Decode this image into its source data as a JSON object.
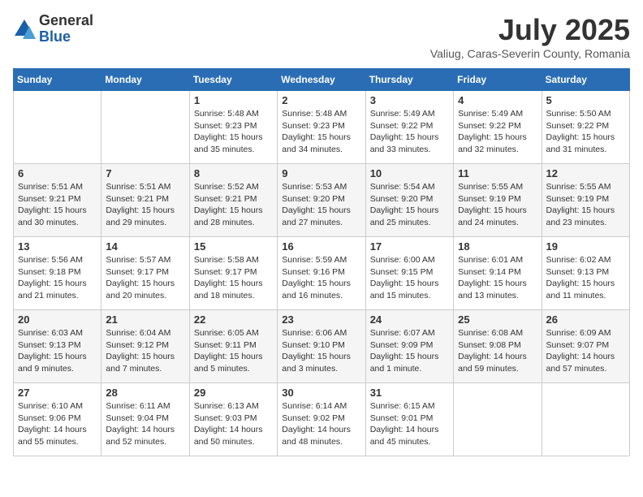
{
  "logo": {
    "general": "General",
    "blue": "Blue"
  },
  "title": "July 2025",
  "subtitle": "Valiug, Caras-Severin County, Romania",
  "headers": [
    "Sunday",
    "Monday",
    "Tuesday",
    "Wednesday",
    "Thursday",
    "Friday",
    "Saturday"
  ],
  "weeks": [
    [
      {
        "day": "",
        "text": ""
      },
      {
        "day": "",
        "text": ""
      },
      {
        "day": "1",
        "text": "Sunrise: 5:48 AM\nSunset: 9:23 PM\nDaylight: 15 hours and 35 minutes."
      },
      {
        "day": "2",
        "text": "Sunrise: 5:48 AM\nSunset: 9:23 PM\nDaylight: 15 hours and 34 minutes."
      },
      {
        "day": "3",
        "text": "Sunrise: 5:49 AM\nSunset: 9:22 PM\nDaylight: 15 hours and 33 minutes."
      },
      {
        "day": "4",
        "text": "Sunrise: 5:49 AM\nSunset: 9:22 PM\nDaylight: 15 hours and 32 minutes."
      },
      {
        "day": "5",
        "text": "Sunrise: 5:50 AM\nSunset: 9:22 PM\nDaylight: 15 hours and 31 minutes."
      }
    ],
    [
      {
        "day": "6",
        "text": "Sunrise: 5:51 AM\nSunset: 9:21 PM\nDaylight: 15 hours and 30 minutes."
      },
      {
        "day": "7",
        "text": "Sunrise: 5:51 AM\nSunset: 9:21 PM\nDaylight: 15 hours and 29 minutes."
      },
      {
        "day": "8",
        "text": "Sunrise: 5:52 AM\nSunset: 9:21 PM\nDaylight: 15 hours and 28 minutes."
      },
      {
        "day": "9",
        "text": "Sunrise: 5:53 AM\nSunset: 9:20 PM\nDaylight: 15 hours and 27 minutes."
      },
      {
        "day": "10",
        "text": "Sunrise: 5:54 AM\nSunset: 9:20 PM\nDaylight: 15 hours and 25 minutes."
      },
      {
        "day": "11",
        "text": "Sunrise: 5:55 AM\nSunset: 9:19 PM\nDaylight: 15 hours and 24 minutes."
      },
      {
        "day": "12",
        "text": "Sunrise: 5:55 AM\nSunset: 9:19 PM\nDaylight: 15 hours and 23 minutes."
      }
    ],
    [
      {
        "day": "13",
        "text": "Sunrise: 5:56 AM\nSunset: 9:18 PM\nDaylight: 15 hours and 21 minutes."
      },
      {
        "day": "14",
        "text": "Sunrise: 5:57 AM\nSunset: 9:17 PM\nDaylight: 15 hours and 20 minutes."
      },
      {
        "day": "15",
        "text": "Sunrise: 5:58 AM\nSunset: 9:17 PM\nDaylight: 15 hours and 18 minutes."
      },
      {
        "day": "16",
        "text": "Sunrise: 5:59 AM\nSunset: 9:16 PM\nDaylight: 15 hours and 16 minutes."
      },
      {
        "day": "17",
        "text": "Sunrise: 6:00 AM\nSunset: 9:15 PM\nDaylight: 15 hours and 15 minutes."
      },
      {
        "day": "18",
        "text": "Sunrise: 6:01 AM\nSunset: 9:14 PM\nDaylight: 15 hours and 13 minutes."
      },
      {
        "day": "19",
        "text": "Sunrise: 6:02 AM\nSunset: 9:13 PM\nDaylight: 15 hours and 11 minutes."
      }
    ],
    [
      {
        "day": "20",
        "text": "Sunrise: 6:03 AM\nSunset: 9:13 PM\nDaylight: 15 hours and 9 minutes."
      },
      {
        "day": "21",
        "text": "Sunrise: 6:04 AM\nSunset: 9:12 PM\nDaylight: 15 hours and 7 minutes."
      },
      {
        "day": "22",
        "text": "Sunrise: 6:05 AM\nSunset: 9:11 PM\nDaylight: 15 hours and 5 minutes."
      },
      {
        "day": "23",
        "text": "Sunrise: 6:06 AM\nSunset: 9:10 PM\nDaylight: 15 hours and 3 minutes."
      },
      {
        "day": "24",
        "text": "Sunrise: 6:07 AM\nSunset: 9:09 PM\nDaylight: 15 hours and 1 minute."
      },
      {
        "day": "25",
        "text": "Sunrise: 6:08 AM\nSunset: 9:08 PM\nDaylight: 14 hours and 59 minutes."
      },
      {
        "day": "26",
        "text": "Sunrise: 6:09 AM\nSunset: 9:07 PM\nDaylight: 14 hours and 57 minutes."
      }
    ],
    [
      {
        "day": "27",
        "text": "Sunrise: 6:10 AM\nSunset: 9:06 PM\nDaylight: 14 hours and 55 minutes."
      },
      {
        "day": "28",
        "text": "Sunrise: 6:11 AM\nSunset: 9:04 PM\nDaylight: 14 hours and 52 minutes."
      },
      {
        "day": "29",
        "text": "Sunrise: 6:13 AM\nSunset: 9:03 PM\nDaylight: 14 hours and 50 minutes."
      },
      {
        "day": "30",
        "text": "Sunrise: 6:14 AM\nSunset: 9:02 PM\nDaylight: 14 hours and 48 minutes."
      },
      {
        "day": "31",
        "text": "Sunrise: 6:15 AM\nSunset: 9:01 PM\nDaylight: 14 hours and 45 minutes."
      },
      {
        "day": "",
        "text": ""
      },
      {
        "day": "",
        "text": ""
      }
    ]
  ]
}
